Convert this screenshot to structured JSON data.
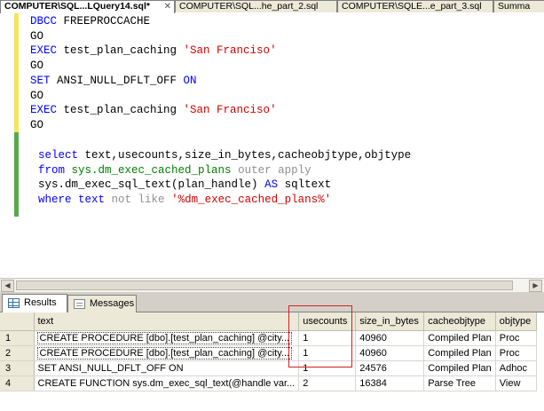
{
  "tabs": [
    {
      "label": "COMPUTER\\SQL...LQuery14.sql*",
      "active": true
    },
    {
      "label": "COMPUTER\\SQL...he_part_2.sql",
      "active": false
    },
    {
      "label": "COMPUTER\\SQLE...e_part_3.sql",
      "active": false
    },
    {
      "label": "Summa",
      "active": false
    }
  ],
  "editor": {
    "script": {
      "dbcc": "DBCC",
      "freeproccache": " FREEPROCCACHE",
      "go": "GO",
      "exec": "EXEC",
      "proc_name": " test_plan_caching ",
      "city_arg": "'San Franciso'",
      "set": "SET",
      "ansi_option": " ANSI_NULL_DFLT_OFF ",
      "on": "ON"
    },
    "query": {
      "select": "select",
      "select_cols": " text,usecounts,size_in_bytes,cacheobjtype,objtype",
      "from": "from",
      "dmv_plans": " sys.dm_exec_cached_plans ",
      "outer_apply": "outer apply",
      "dmv_text": "sys.dm_exec_sql_text",
      "plan_handle": "(plan_handle) ",
      "as": "AS",
      "alias": " sqltext",
      "where": "where",
      "text_col": " text ",
      "not_like": "not like",
      "pattern": "'%dm_exec_cached_plans%'"
    }
  },
  "results_tabs": [
    {
      "label": "Results",
      "icon": "grid-icon",
      "active": true
    },
    {
      "label": "Messages",
      "icon": "messages-icon",
      "active": false
    }
  ],
  "grid": {
    "columns": [
      "text",
      "usecounts",
      "size_in_bytes",
      "cacheobjtype",
      "objtype"
    ],
    "rows": [
      {
        "num": "1",
        "text": "CREATE PROCEDURE [dbo].[test_plan_caching] @city...",
        "usecounts": "1",
        "size_in_bytes": "40960",
        "cacheobjtype": "Compiled Plan",
        "objtype": "Proc"
      },
      {
        "num": "2",
        "text": "CREATE PROCEDURE [dbo].[test_plan_caching] @city...",
        "usecounts": "1",
        "size_in_bytes": "40960",
        "cacheobjtype": "Compiled Plan",
        "objtype": "Proc"
      },
      {
        "num": "3",
        "text": "SET ANSI_NULL_DFLT_OFF ON",
        "usecounts": "1",
        "size_in_bytes": "24576",
        "cacheobjtype": "Compiled Plan",
        "objtype": "Adhoc"
      },
      {
        "num": "4",
        "text": "CREATE FUNCTION sys.dm_exec_sql_text(@handle var...",
        "usecounts": "2",
        "size_in_bytes": "16384",
        "cacheobjtype": "Parse Tree",
        "objtype": "View"
      }
    ]
  },
  "colors": {
    "keyword": "#0000ff",
    "string": "#d10000",
    "function": "#c000c0",
    "system_object": "#008000",
    "operator": "#909090",
    "highlight_box": "#d42020"
  }
}
